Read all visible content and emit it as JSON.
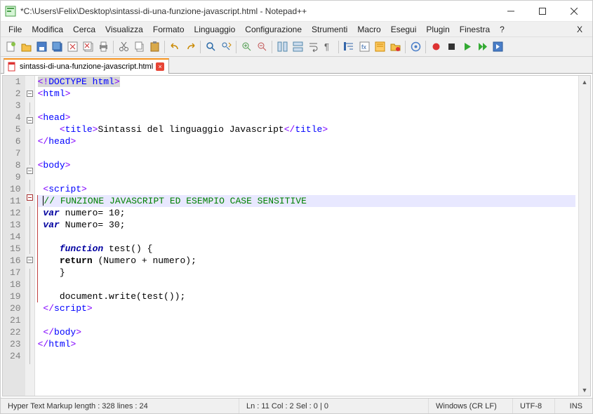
{
  "window": {
    "title": "*C:\\Users\\Felix\\Desktop\\sintassi-di-una-funzione-javascript.html - Notepad++"
  },
  "menu": {
    "items": [
      "File",
      "Modifica",
      "Cerca",
      "Visualizza",
      "Formato",
      "Linguaggio",
      "Configurazione",
      "Strumenti",
      "Macro",
      "Esegui",
      "Plugin",
      "Finestra",
      "?"
    ],
    "right": "X"
  },
  "toolbar": {
    "icons": [
      "new-file-icon",
      "open-file-icon",
      "save-icon",
      "save-all-icon",
      "close-icon",
      "close-all-icon",
      "print-icon",
      "sep",
      "cut-icon",
      "copy-icon",
      "paste-icon",
      "sep",
      "undo-icon",
      "redo-icon",
      "sep",
      "find-icon",
      "replace-icon",
      "sep",
      "zoom-in-icon",
      "zoom-out-icon",
      "sep",
      "sync-v-icon",
      "sync-h-icon",
      "wrap-icon",
      "all-chars-icon",
      "sep",
      "indent-guide-icon",
      "lang-icon",
      "doc-map-icon",
      "folder-icon",
      "sep",
      "monitor-icon",
      "sep",
      "record-icon",
      "stop-icon",
      "play-icon",
      "play-multi-icon",
      "save-macro-icon"
    ]
  },
  "tab": {
    "filename": "sintassi-di-una-funzione-javascript.html"
  },
  "code": {
    "lines": [
      [
        [
          "hi-brkt",
          "<!"
        ],
        [
          "hi-tag",
          "DOCTYPE"
        ],
        [
          "hi-text",
          " "
        ],
        [
          "hi-tag",
          "html"
        ],
        [
          "hi-brkt",
          ">"
        ]
      ],
      [
        [
          "brkt",
          "<"
        ],
        [
          "tag",
          "html"
        ],
        [
          "brkt",
          ">"
        ]
      ],
      [],
      [
        [
          "brkt",
          "<"
        ],
        [
          "tag",
          "head"
        ],
        [
          "brkt",
          ">"
        ]
      ],
      [
        [
          "text",
          "    "
        ],
        [
          "brkt",
          "<"
        ],
        [
          "tag",
          "title"
        ],
        [
          "brkt",
          ">"
        ],
        [
          "text",
          "Sintassi del linguaggio Javascript"
        ],
        [
          "brkt",
          "</"
        ],
        [
          "tag",
          "title"
        ],
        [
          "brkt",
          ">"
        ]
      ],
      [
        [
          "brkt",
          "</"
        ],
        [
          "tag",
          "head"
        ],
        [
          "brkt",
          ">"
        ]
      ],
      [],
      [
        [
          "brkt",
          "<"
        ],
        [
          "tag",
          "body"
        ],
        [
          "brkt",
          ">"
        ]
      ],
      [],
      [
        [
          "text",
          " "
        ],
        [
          "brkt",
          "<"
        ],
        [
          "tag",
          "script"
        ],
        [
          "brkt",
          ">"
        ]
      ],
      [
        [
          "text",
          " "
        ],
        [
          "caret",
          ""
        ],
        [
          "cmt",
          "// FUNZIONE JAVASCRIPT ED ESEMPIO CASE SENSITIVE"
        ]
      ],
      [
        [
          "text",
          " "
        ],
        [
          "kw",
          "var"
        ],
        [
          "text",
          " numero= 10;"
        ]
      ],
      [
        [
          "text",
          " "
        ],
        [
          "kw",
          "var"
        ],
        [
          "text",
          " Numero= 30;"
        ]
      ],
      [],
      [
        [
          "text",
          "    "
        ],
        [
          "kw",
          "function"
        ],
        [
          "text",
          " test() {"
        ]
      ],
      [
        [
          "text",
          "    "
        ],
        [
          "kw2",
          "return"
        ],
        [
          "text",
          " (Numero + numero);"
        ]
      ],
      [
        [
          "text",
          "    }"
        ]
      ],
      [],
      [
        [
          "text",
          "    document.write(test());"
        ]
      ],
      [
        [
          "text",
          " "
        ],
        [
          "brkt",
          "</"
        ],
        [
          "tag",
          "script"
        ],
        [
          "brkt",
          ">"
        ]
      ],
      [],
      [
        [
          "text",
          " "
        ],
        [
          "brkt",
          "</"
        ],
        [
          "tag",
          "body"
        ],
        [
          "brkt",
          ">"
        ]
      ],
      [
        [
          "brkt",
          "</"
        ],
        [
          "tag",
          "html"
        ],
        [
          "brkt",
          ">"
        ]
      ],
      []
    ],
    "fold": {
      "2": "minus",
      "4": "minus",
      "8": "minus",
      "10": "minus-red",
      "15": "minus"
    },
    "foldline_rows": [
      3,
      5,
      6,
      7,
      9,
      11,
      12,
      13,
      14,
      16,
      17,
      18,
      19,
      20,
      21,
      22,
      23
    ],
    "vred_rows": [
      11,
      12,
      13,
      14,
      15,
      16,
      17,
      18,
      19
    ],
    "highlight_row": 11
  },
  "status": {
    "left": "Hyper Text Markup   length : 328     lines : 24",
    "middle": "Ln : 11    Col : 2    Sel : 0 | 0",
    "eol": "Windows (CR LF)",
    "enc": "UTF-8",
    "mode": "INS"
  }
}
